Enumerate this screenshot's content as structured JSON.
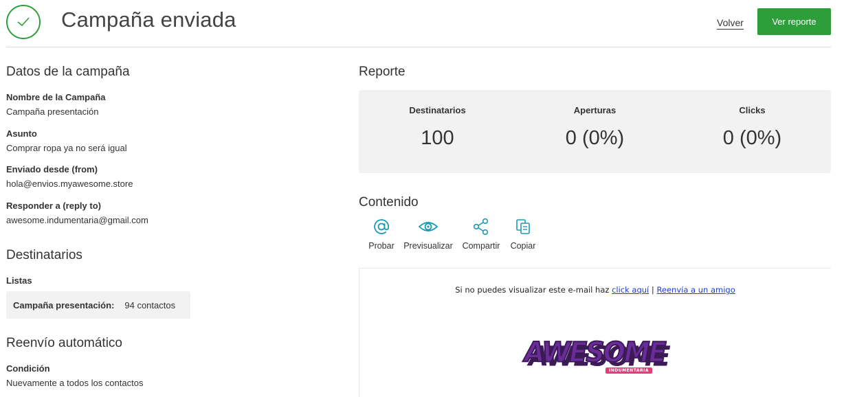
{
  "header": {
    "title": "Campaña enviada",
    "back_label": "Volver",
    "report_button_label": "Ver reporte",
    "accent_color": "#2e9e3b"
  },
  "campaign": {
    "section_title": "Datos de la campaña",
    "fields": [
      {
        "label": "Nombre de la Campaña",
        "value": "Campaña presentación"
      },
      {
        "label": "Asunto",
        "value": "Comprar ropa ya no será igual"
      },
      {
        "label": "Enviado desde (from)",
        "value": "hola@envios.myawesome.store"
      },
      {
        "label": "Responder a (reply to)",
        "value": "awesome.indumentaria@gmail.com"
      }
    ]
  },
  "recipients": {
    "section_title": "Destinatarios",
    "lists_label": "Listas",
    "list_name": "Campaña presentación:",
    "list_count": "94 contactos"
  },
  "autoresend": {
    "section_title": "Reenvío automático",
    "condition_label": "Condición",
    "condition_value": "Nuevamente a todos los contactos"
  },
  "report": {
    "section_title": "Reporte",
    "stats": [
      {
        "label": "Destinatarios",
        "value": "100"
      },
      {
        "label": "Aperturas",
        "value": "0 (0%)"
      },
      {
        "label": "Clicks",
        "value": "0 (0%)"
      }
    ]
  },
  "content": {
    "section_title": "Contenido",
    "icon_color": "#1a9bb3",
    "actions": [
      {
        "label": "Probar",
        "icon": "at-sign-icon"
      },
      {
        "label": "Previsualizar",
        "icon": "eye-icon"
      },
      {
        "label": "Compartir",
        "icon": "share-icon"
      },
      {
        "label": "Copiar",
        "icon": "copy-icon"
      }
    ],
    "preview": {
      "note_text": "Si no puedes visualizar este e-mail haz",
      "click_link": "click aquí",
      "separator": "|",
      "forward_link": "Reenvía a un amigo",
      "logo_text": "AWESOME",
      "logo_badge": "INDUMENTARIA"
    }
  }
}
